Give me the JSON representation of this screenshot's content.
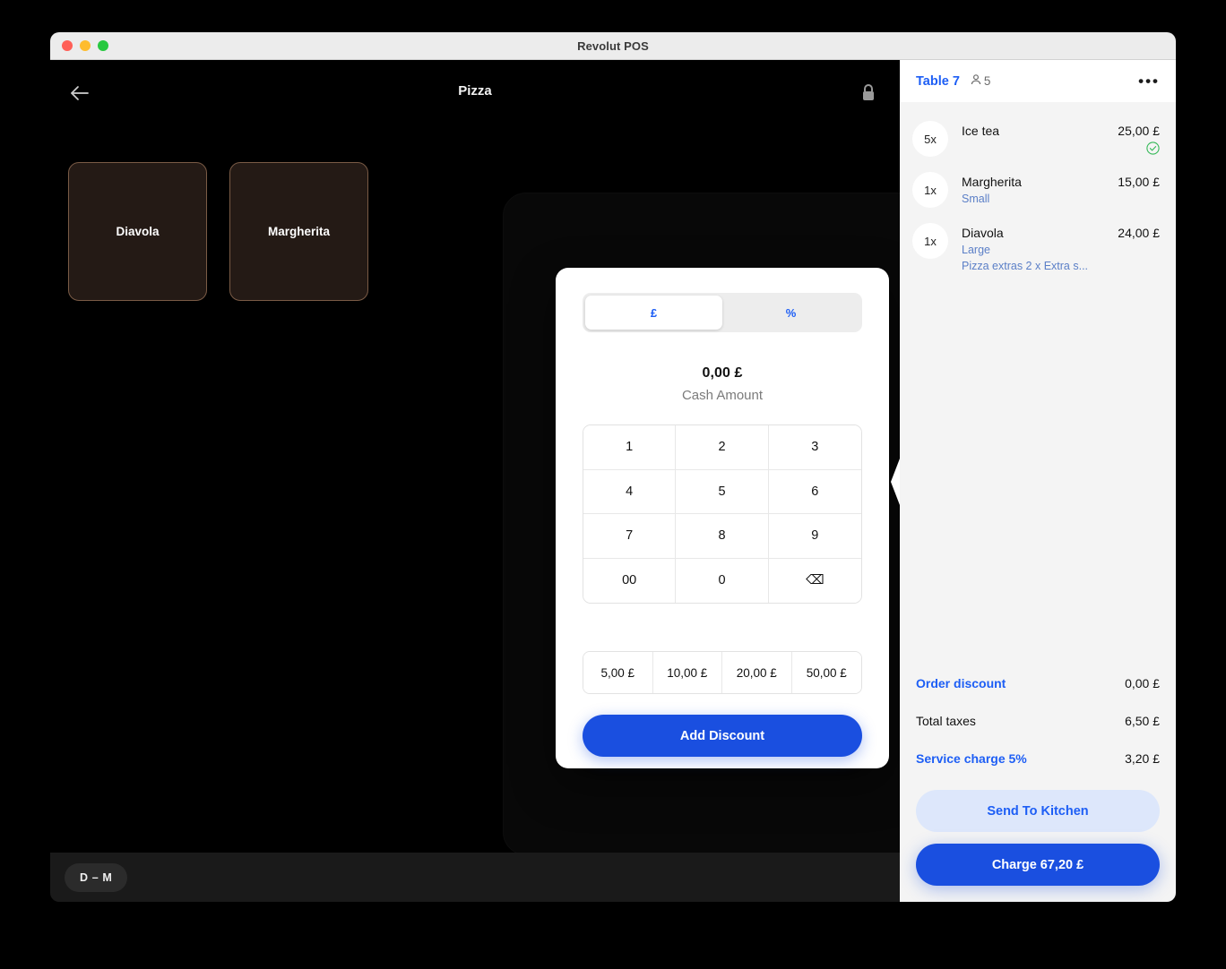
{
  "window": {
    "title": "Revolut POS",
    "traffic_lights": [
      "close-red",
      "minimize-yellow",
      "maximize-green"
    ]
  },
  "canvas": {
    "title": "Pizza",
    "back_icon": "arrow-left-icon",
    "lock_icon": "lock-closed-icon",
    "tiles": [
      {
        "label": "Diavola"
      },
      {
        "label": "Margherita"
      }
    ],
    "bottom_badge": "D – M"
  },
  "discount_modal": {
    "segments": [
      {
        "label": "£",
        "active": true
      },
      {
        "label": "%",
        "active": false
      }
    ],
    "amount_value": "0,00 £",
    "amount_label": "Cash Amount",
    "keypad": [
      "1",
      "2",
      "3",
      "4",
      "5",
      "6",
      "7",
      "8",
      "9",
      "00",
      "0",
      "⌫"
    ],
    "quick_amounts": [
      "5,00 £",
      "10,00 £",
      "20,00 £",
      "50,00 £"
    ],
    "submit_label": "Add Discount"
  },
  "order_panel": {
    "table_label": "Table 7",
    "guests_icon": "person-icon",
    "guests_count": "5",
    "more_icon": "ellipsis-icon",
    "items": [
      {
        "qty": "5x",
        "name": "Ice tea",
        "price": "25,00 £",
        "options": [],
        "sent_to_kitchen": true
      },
      {
        "qty": "1x",
        "name": "Margherita",
        "price": "15,00 £",
        "options": [
          "Small"
        ],
        "sent_to_kitchen": false
      },
      {
        "qty": "1x",
        "name": "Diavola",
        "price": "24,00 £",
        "options": [
          "Large",
          "Pizza extras 2 x Extra s..."
        ],
        "sent_to_kitchen": false
      }
    ],
    "totals": [
      {
        "label": "Order discount",
        "value": "0,00 £",
        "link": true
      },
      {
        "label": "Total taxes",
        "value": "6,50 £",
        "link": false
      },
      {
        "label": "Service charge 5%",
        "value": "3,20 £",
        "link": true
      }
    ],
    "send_label": "Send To Kitchen",
    "charge_label": "Charge 67,20 £"
  },
  "colors": {
    "accent_blue": "#1a4fe0",
    "link_blue": "#1d5ef5",
    "panel_bg": "#f4f4f4",
    "tile_bg": "#241a15",
    "tile_border": "#7a5b46",
    "success_green": "#34b857"
  }
}
